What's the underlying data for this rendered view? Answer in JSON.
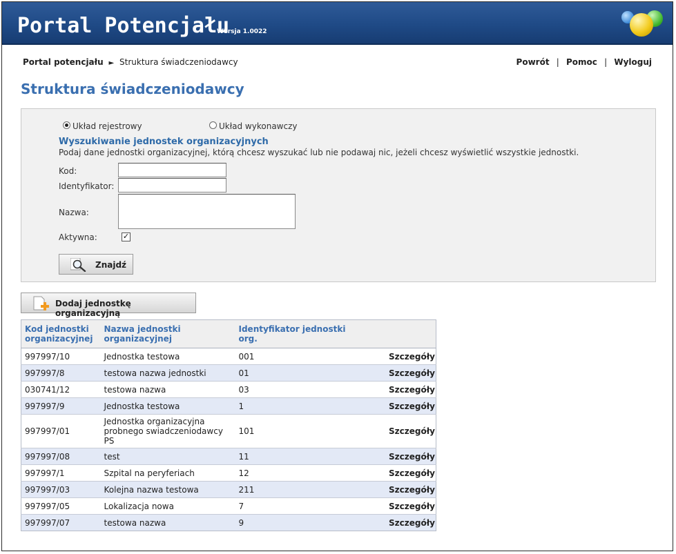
{
  "header": {
    "app_title": "Portal Potencjału",
    "version": "Wersja 1.0022"
  },
  "breadcrumb": {
    "root": "Portal potencjału",
    "separator": "►",
    "current": "Struktura świadczeniodawcy"
  },
  "topnav": {
    "back": "Powrót",
    "help": "Pomoc",
    "logout": "Wyloguj",
    "separator": "|"
  },
  "page_title": "Struktura świadczeniodawcy",
  "search": {
    "radio_registry": "Układ rejestrowy",
    "radio_executive": "Układ wykonawczy",
    "section_title": "Wyszukiwanie jednostek organizacyjnych",
    "description": "Podaj dane jednostki organizacyjnej, którą chcesz wyszukać lub nie podawaj nic, jeżeli chcesz wyświetlić wszystkie jednostki.",
    "code_label": "Kod:",
    "code_value": "",
    "identifier_label": "Identyfikator:",
    "identifier_value": "",
    "name_label": "Nazwa:",
    "name_value": "",
    "active_label": "Aktywna:",
    "active_checked": true,
    "find_button": "Znajdź"
  },
  "add_button": "Dodaj jednostkę organizacyjną",
  "table": {
    "columns": [
      "Kod jednostki organizacyjnej",
      "Nazwa jednostki organizacyjnej",
      "Identyfikator jednostki org."
    ],
    "details_label": "Szczegóły",
    "rows": [
      {
        "code": "997997/10",
        "name": "Jednostka testowa",
        "id": "001"
      },
      {
        "code": "997997/8",
        "name": "testowa nazwa jednostki",
        "id": "01"
      },
      {
        "code": "030741/12",
        "name": "testowa nazwa",
        "id": "03"
      },
      {
        "code": "997997/9",
        "name": "Jednostka testowa",
        "id": "1"
      },
      {
        "code": "997997/01",
        "name": "Jednostka organizacyjna probnego swiadczeniodawcy PS",
        "id": "101"
      },
      {
        "code": "997997/08",
        "name": "test",
        "id": "11"
      },
      {
        "code": "997997/1",
        "name": "Szpital na peryferiach",
        "id": "12"
      },
      {
        "code": "997997/03",
        "name": "Kolejna nazwa testowa",
        "id": "211"
      },
      {
        "code": "997997/05",
        "name": "Lokalizacja nowa",
        "id": "7"
      },
      {
        "code": "997997/07",
        "name": "testowa nazwa",
        "id": "9"
      }
    ]
  },
  "colors": {
    "header_blue": "#1f4a86",
    "title_blue": "#3a6fb0",
    "row_alt": "#e3e9f6"
  },
  "icons": [
    "magnifier-icon",
    "add-document-icon",
    "logo-balls-icon"
  ]
}
